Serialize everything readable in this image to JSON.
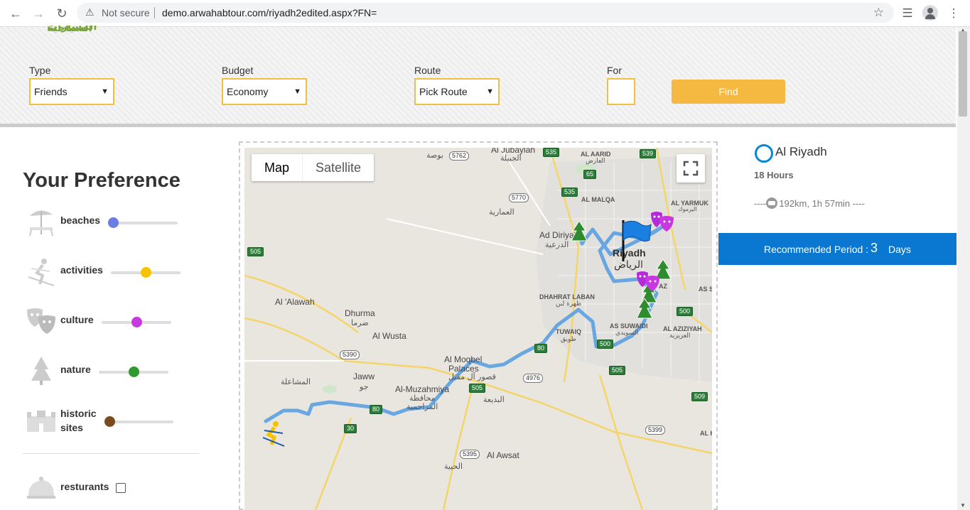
{
  "browser": {
    "security_label": "Not secure",
    "url": "demo.arwahabtour.com/riyadh2edited.aspx?FN=",
    "icons": [
      "back-icon",
      "forward-icon",
      "reload-icon",
      "warning-icon",
      "star-icon",
      "media-icon",
      "profile-icon",
      "menu-icon"
    ]
  },
  "header": {
    "logo_text": "المسارات السياحية",
    "type": {
      "label": "Type",
      "value": "Friends"
    },
    "budget": {
      "label": "Budget",
      "value": "Economy"
    },
    "route": {
      "label": "Route",
      "value": "Pick Route"
    },
    "for": {
      "label": "For",
      "value": ""
    },
    "find_label": "Find"
  },
  "preferences": {
    "title": "Your Preference",
    "items": [
      {
        "label": "beaches",
        "value": 0.0,
        "color": "#6b7ce0",
        "icon": "beach-umbrella-icon"
      },
      {
        "label": "activities",
        "value": 0.5,
        "color": "#f5c400",
        "icon": "skier-icon"
      },
      {
        "label": "culture",
        "value": 0.5,
        "color": "#c837e0",
        "icon": "theater-masks-icon"
      },
      {
        "label": "nature",
        "value": 0.5,
        "color": "#2e9a2e",
        "icon": "tree-icon"
      },
      {
        "label": "historic sites",
        "label_line1": "historic",
        "label_line2": "sites",
        "value": 0.0,
        "color": "#7b4a1e",
        "icon": "castle-icon"
      }
    ],
    "restaurants": {
      "label": "resturants",
      "checked": false,
      "icon": "food-cloche-icon"
    }
  },
  "map": {
    "type_tabs": [
      "Map",
      "Satellite"
    ],
    "active_tab": "Map",
    "labels": {
      "jubaylah": "Al Jubaylah",
      "jubaylah_ar": "الجبيلة",
      "busa_ar": "بوصة",
      "aarid": "AL AARID",
      "aarid_ar": "العارض",
      "ammariyah_ar": "العمارية",
      "malqa": "AL MALQA",
      "yarmuk": "AL YARMUK",
      "yarmuk_ar": "اليرموك",
      "diriyah": "Ad Diriyah",
      "diriyah_ar": "الدرعية",
      "riyadh": "Riyadh",
      "riyadh_ar": "الرياض",
      "alawah": "Al 'Alawah",
      "dhurma": "Dhurma",
      "dhurma_ar": "ضرما",
      "dhahrat": "DHAHRAT LABAN",
      "dhahrat_ar": "ظهرة لبن",
      "wusta": "Al Wusta",
      "suwaidi": "AS SUWAIDI",
      "suwaidi_ar": "السويدي",
      "aziziyah": "AL AZIZIYAH",
      "aziziyah_ar": "العزيزية",
      "tuwaiq": "TUWAIQ",
      "tuwaiq_ar": "طويق",
      "moqbel1": "Al Moqbel",
      "moqbel2": "Palaces",
      "moqbel_ar": "قصور آل مقبل",
      "jaww": "Jaww",
      "jaww_ar": "جو",
      "mashalah_ar": "المشاعلة",
      "muzahmiya": "Al-Muzahmiya",
      "muzahmiya_ar1": "محافظة",
      "muzahmiya_ar2": "المزاحمية",
      "badiah_ar": "البديعة",
      "awsat": "Al Awsat",
      "hayah_ar": "الحيية",
      "as_s": "AS S",
      "az": "AZ",
      "al_k": "AL K"
    },
    "shields": [
      "5762",
      "535",
      "539",
      "65",
      "5770",
      "535",
      "505",
      "500",
      "80",
      "500",
      "5390",
      "505",
      "4976",
      "80",
      "505",
      "509",
      "5399",
      "30",
      "5395"
    ]
  },
  "summary": {
    "city": "Al Riyadh",
    "duration": "18 Hours",
    "route_info": "192km, 1h 57min ----",
    "route_prefix": "----",
    "recommended_label": "Recommended Period :",
    "recommended_value": "3",
    "recommended_unit": "Days"
  },
  "colors": {
    "accent": "#f5b942",
    "select_border": "#f0c040",
    "primary": "#0a78d1",
    "route": "#5aa0e0"
  }
}
